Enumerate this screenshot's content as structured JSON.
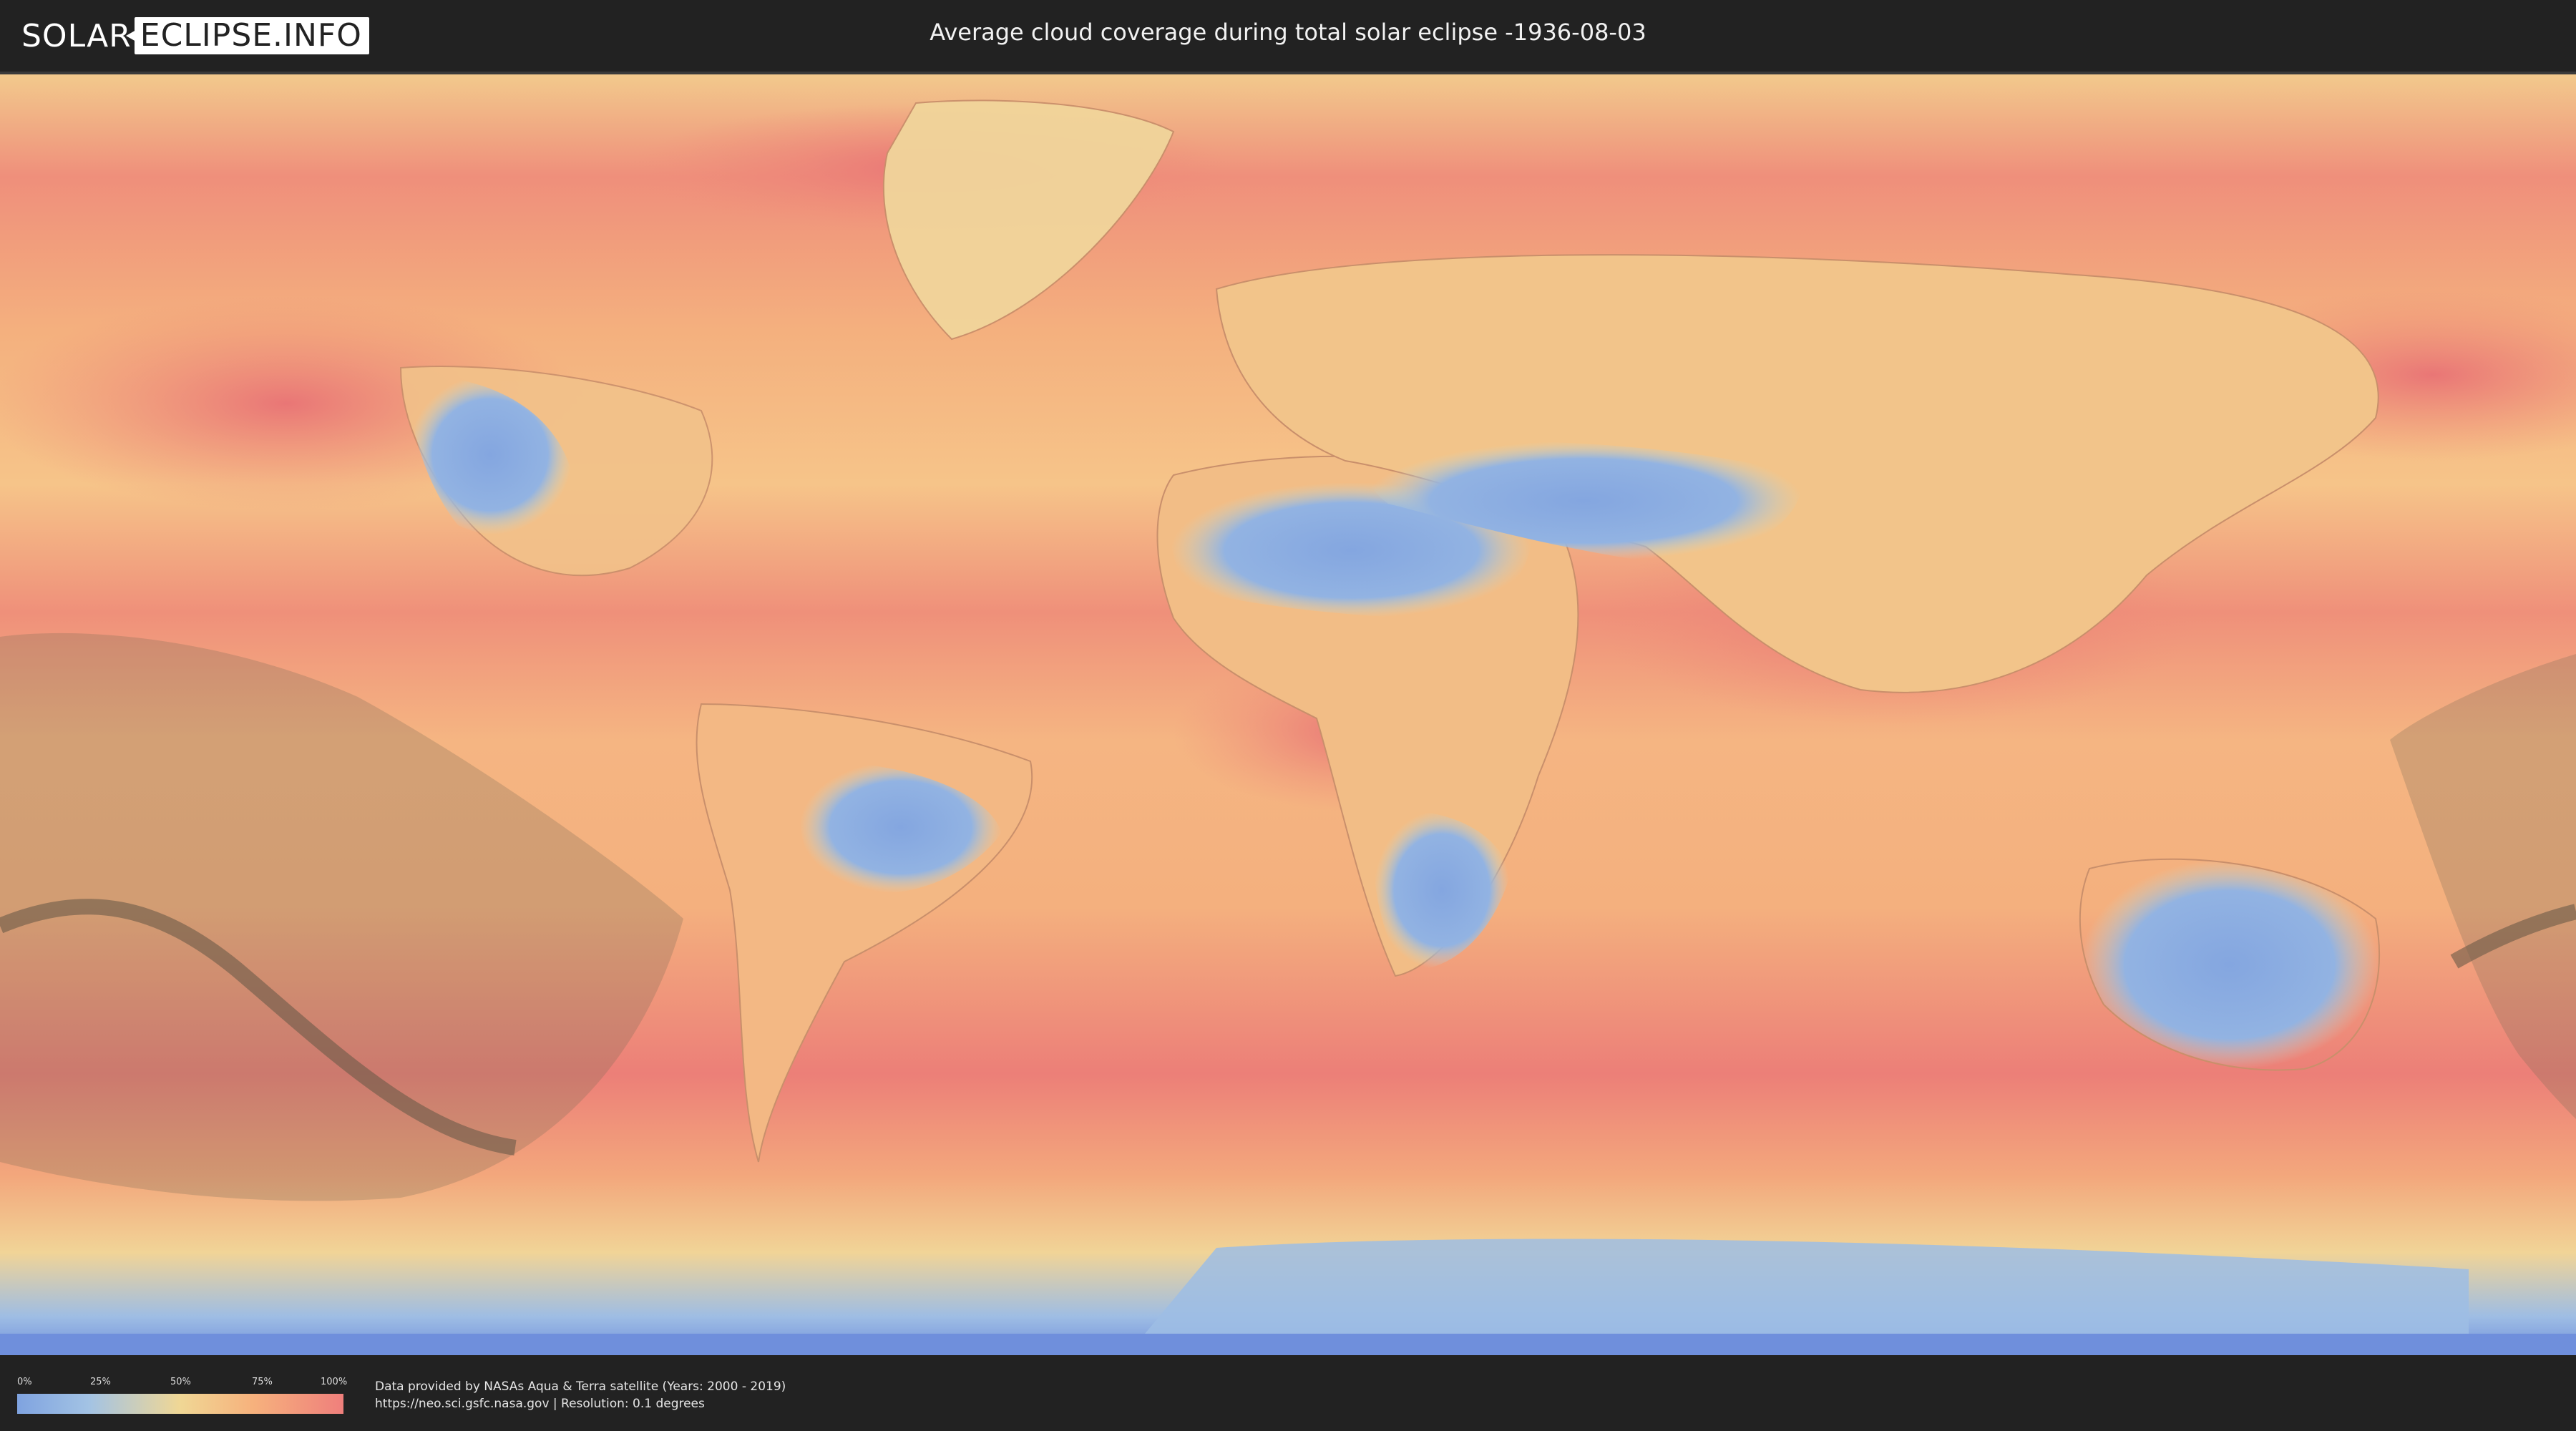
{
  "header": {
    "logo_left": "SOLAR",
    "logo_right": "ECLIPSE.INFO",
    "title": "Average cloud coverage during total solar eclipse -1936-08-03"
  },
  "legend": {
    "ticks": [
      "0%",
      "25%",
      "50%",
      "75%",
      "100%"
    ],
    "colors": {
      "low": "#7fa3e0",
      "mid_low": "#a3c3e4",
      "mid": "#f0d795",
      "mid_high": "#f6b27d",
      "high": "#ef7f7c"
    }
  },
  "footer": {
    "credit_line1": "Data provided by NASAs Aqua & Terra satellite (Years: 2000 - 2019)",
    "credit_line2": "https://neo.sci.gsfc.nasa.gov | Resolution: 0.1 degrees"
  },
  "map": {
    "eclipse_shadow_color": "#7a6a55",
    "eclipse_path_color": "#6b5a48"
  }
}
